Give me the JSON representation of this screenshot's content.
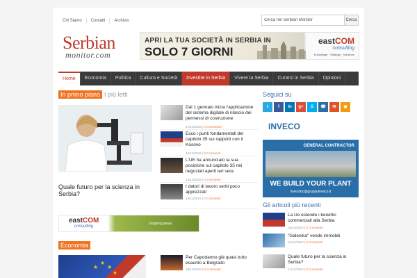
{
  "top_nav": {
    "links": [
      "Chi Siamo",
      "Contatti",
      "Archivio"
    ],
    "search_placeholder": "Cerca nel Serbian Monitor",
    "search_button": "Cerca"
  },
  "logo": {
    "main": "Serbian",
    "sub": "monitor.com"
  },
  "banner": {
    "line1": "APRI LA TUA SOCIETÀ IN SERBIA IN",
    "line2": "SOLO 7 GIORNI",
    "brand_east": "east",
    "brand_com": "COM",
    "brand_sub": "consulting",
    "brand_tag": "Knowledge · Strategy · Solutions"
  },
  "main_nav": [
    {
      "label": "Home",
      "state": "active"
    },
    {
      "label": "Economia",
      "state": ""
    },
    {
      "label": "Politica",
      "state": ""
    },
    {
      "label": "Cultura e Società",
      "state": ""
    },
    {
      "label": "Investire in Serbia",
      "state": "highlight"
    },
    {
      "label": "Vivere la Serbia",
      "state": ""
    },
    {
      "label": "Curarsi in Serbia",
      "state": ""
    },
    {
      "label": "Opinioni",
      "state": ""
    }
  ],
  "featured": {
    "tag": "In primo piano",
    "alt": "I più letti",
    "main_title": "Quale futuro per la scienza in Serbia?",
    "items": [
      {
        "title": "Dal 1 gennaio inizia l'applicazione del sistema digitale di rilascio dei permessi di costruzione",
        "date": "17/12/2015",
        "comments": "0 Comments"
      },
      {
        "title": "Ecco i punti fondamentali del capitolo 35 sui rapporti con il Kosovo",
        "date": "15/12/2015",
        "comments": "0 Commenti"
      },
      {
        "title": "L'UE ha annunciato la sua posizione sul capitolo 35 nei negoziati aperti ieri sera",
        "date": "15/12/2015",
        "comments": "0 Commenti"
      },
      {
        "title": "I datori di lavoro serbi poco apprezzati",
        "date": "14/12/2015",
        "comments": "0 Commenti"
      }
    ]
  },
  "sidebar": {
    "follow_title": "Seguici su",
    "social": [
      {
        "name": "twitter-icon",
        "label": "t",
        "color": "#2aa9e0"
      },
      {
        "name": "facebook-icon",
        "label": "f",
        "color": "#3b5998"
      },
      {
        "name": "linkedin-icon",
        "label": "in",
        "color": "#0077b5"
      },
      {
        "name": "googleplus-icon",
        "label": "g+",
        "color": "#dd4b39"
      },
      {
        "name": "skype-icon",
        "label": "S",
        "color": "#00aff0"
      },
      {
        "name": "phone-icon",
        "label": "☎",
        "color": "#2a6ea8"
      },
      {
        "name": "email-icon",
        "label": "✉",
        "color": "#e0522a"
      },
      {
        "name": "rss-icon",
        "label": "◉",
        "color": "#f39c12"
      }
    ],
    "inveco": {
      "logo": "INVECO",
      "gc": "GENERAL CONTRACTOR",
      "slogan": "WE BUILD YOUR PLANT",
      "email": "invecobc@gruppoinveco.it"
    },
    "articles_title": "Gli articoli più recenti",
    "articles": [
      {
        "title": "La Ue estende i benefici commerciali alla Serbia",
        "date": "18/12/2015",
        "comments": "0 Commenti"
      },
      {
        "title": "\"Galenika\" vende immobili",
        "date": "18/12/2015",
        "comments": "0 Commenti"
      },
      {
        "title": "Quale futuro per la scienza in Serbia?",
        "date": "17/12/2015",
        "comments": "0 Commenti"
      }
    ]
  },
  "eastcom_ad": {
    "east": "east",
    "com": "COM",
    "sub": "consulting",
    "tag": "Inspiring ideas"
  },
  "economia": {
    "tag": "Economia",
    "items": [
      {
        "title": "Per Capodanno già quasi tutto esaurito a Belgrado",
        "date": "18/12/2015",
        "comments": "0 Commenti"
      }
    ]
  }
}
